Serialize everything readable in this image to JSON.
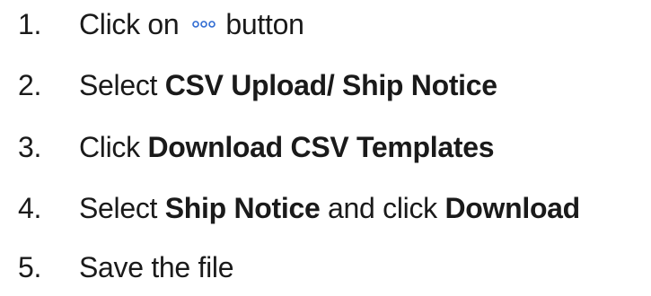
{
  "steps": [
    {
      "number": "1.",
      "before": "Click on",
      "icon": "more-options-dots-icon",
      "after": "button"
    },
    {
      "number": "2.",
      "text": "Select",
      "bold": "CSV Upload/ Ship Notice"
    },
    {
      "number": "3.",
      "text": "Click",
      "bold": "Download CSV Templates"
    },
    {
      "number": "4.",
      "text": "Select",
      "bold": "Ship Notice",
      "mid": "and click",
      "bold2": "Download"
    },
    {
      "number": "5.",
      "text": "Save the file"
    }
  ],
  "colors": {
    "text": "#1a1a1a",
    "icon": "#2f6bd2"
  }
}
